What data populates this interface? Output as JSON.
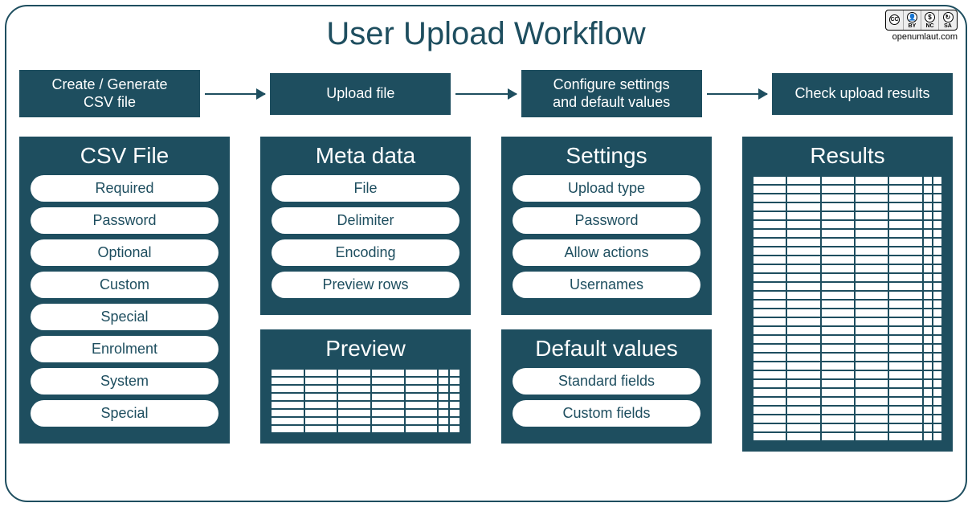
{
  "title": "User Upload Workflow",
  "attribution": "openumlaut.com",
  "license": {
    "parts": [
      "CC",
      "BY",
      "NC",
      "SA"
    ]
  },
  "steps": [
    "Create / Generate\nCSV file",
    "Upload file",
    "Configure settings\nand default values",
    "Check upload results"
  ],
  "columns": [
    {
      "panels": [
        {
          "title": "CSV File",
          "type": "pills",
          "items": [
            "Required",
            "Password",
            "Optional",
            "Custom",
            "Special",
            "Enrolment",
            "System",
            "Special"
          ]
        }
      ]
    },
    {
      "panels": [
        {
          "title": "Meta data",
          "type": "pills",
          "items": [
            "File",
            "Delimiter",
            "Encoding",
            "Preview rows"
          ]
        },
        {
          "title": "Preview",
          "type": "grid-small"
        }
      ]
    },
    {
      "panels": [
        {
          "title": "Settings",
          "type": "pills",
          "items": [
            "Upload type",
            "Password",
            "Allow actions",
            "Usernames"
          ]
        },
        {
          "title": "Default values",
          "type": "pills",
          "items": [
            "Standard fields",
            "Custom fields"
          ]
        }
      ]
    },
    {
      "panels": [
        {
          "title": "Results",
          "type": "grid-large"
        }
      ]
    }
  ],
  "colors": {
    "primary": "#1e4e5f",
    "bg": "#ffffff"
  }
}
